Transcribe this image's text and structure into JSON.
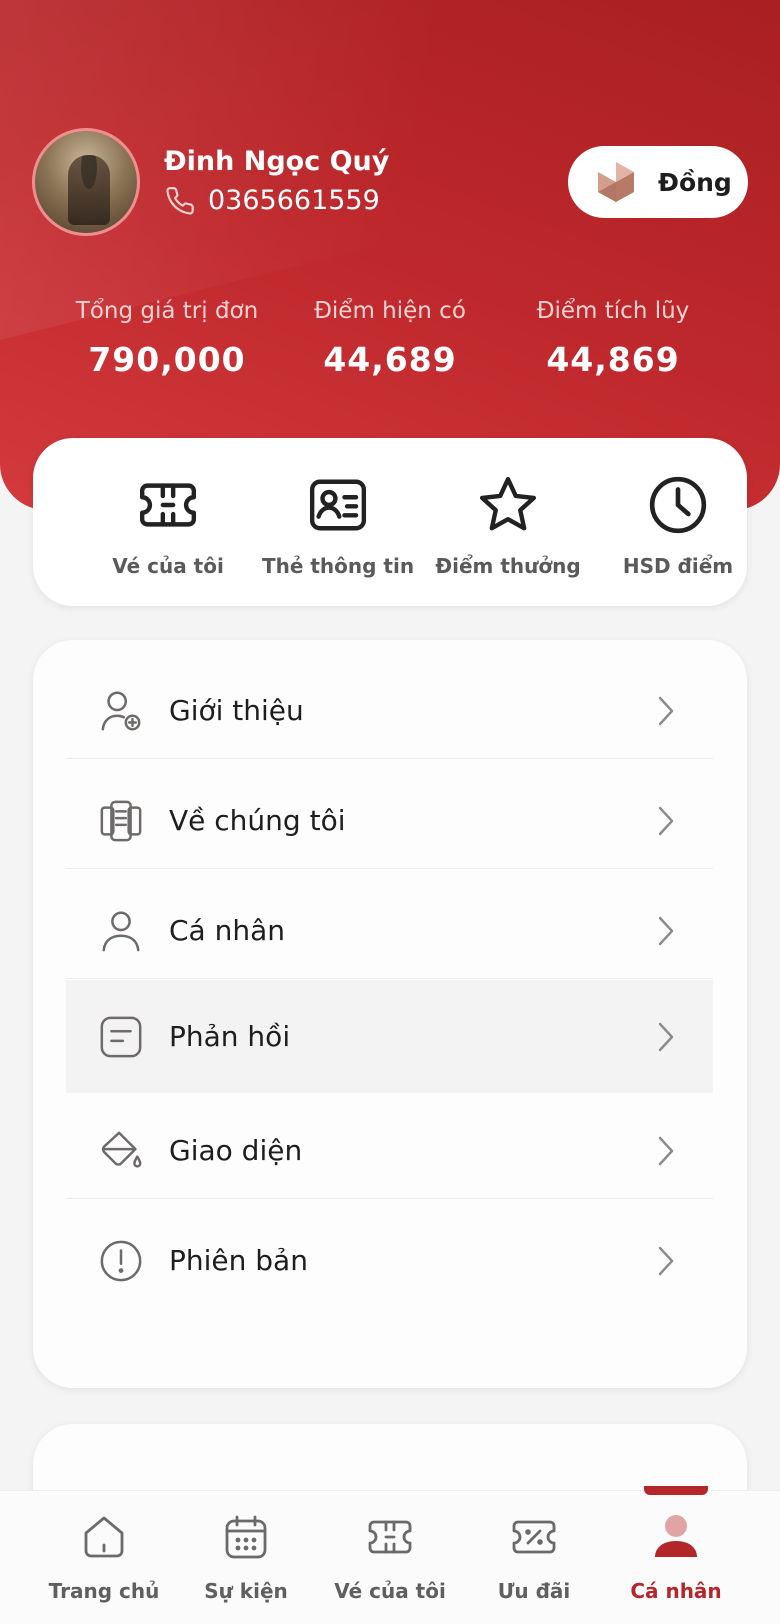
{
  "profile": {
    "name": "Đinh Ngọc Quý",
    "phone": "0365661559",
    "tier": "Đồng"
  },
  "stats": [
    {
      "label": "Tổng giá trị đơn",
      "value": "790,000"
    },
    {
      "label": "Điểm hiện có",
      "value": "44,689"
    },
    {
      "label": "Điểm tích lũy",
      "value": "44,869"
    }
  ],
  "quick_actions": [
    {
      "label": "Vé của tôi",
      "icon": "ticket-icon"
    },
    {
      "label": "Thẻ thông tin",
      "icon": "id-card-icon"
    },
    {
      "label": "Điểm thưởng",
      "icon": "star-icon"
    },
    {
      "label": "HSD điểm",
      "icon": "clock-icon"
    }
  ],
  "menu": [
    {
      "label": "Giới thiệu",
      "icon": "user-add-icon"
    },
    {
      "label": "Về chúng tôi",
      "icon": "about-icon"
    },
    {
      "label": "Cá nhân",
      "icon": "user-icon"
    },
    {
      "label": "Phản hồi",
      "icon": "feedback-icon",
      "active": true
    },
    {
      "label": "Giao diện",
      "icon": "paint-bucket-icon"
    },
    {
      "label": "Phiên bản",
      "icon": "info-icon"
    }
  ],
  "tabbar": [
    {
      "label": "Trang chủ",
      "icon": "home-icon"
    },
    {
      "label": "Sự kiện",
      "icon": "calendar-icon"
    },
    {
      "label": "Vé của tôi",
      "icon": "ticket-icon"
    },
    {
      "label": "Ưu đãi",
      "icon": "discount-icon"
    },
    {
      "label": "Cá nhân",
      "icon": "profile-icon",
      "selected": true
    }
  ],
  "colors": {
    "brand_red": "#b3262a",
    "hero_gradient_start": "#a91f22",
    "hero_gradient_end": "#d33a3e",
    "tier_bronze": "#c08a78"
  }
}
